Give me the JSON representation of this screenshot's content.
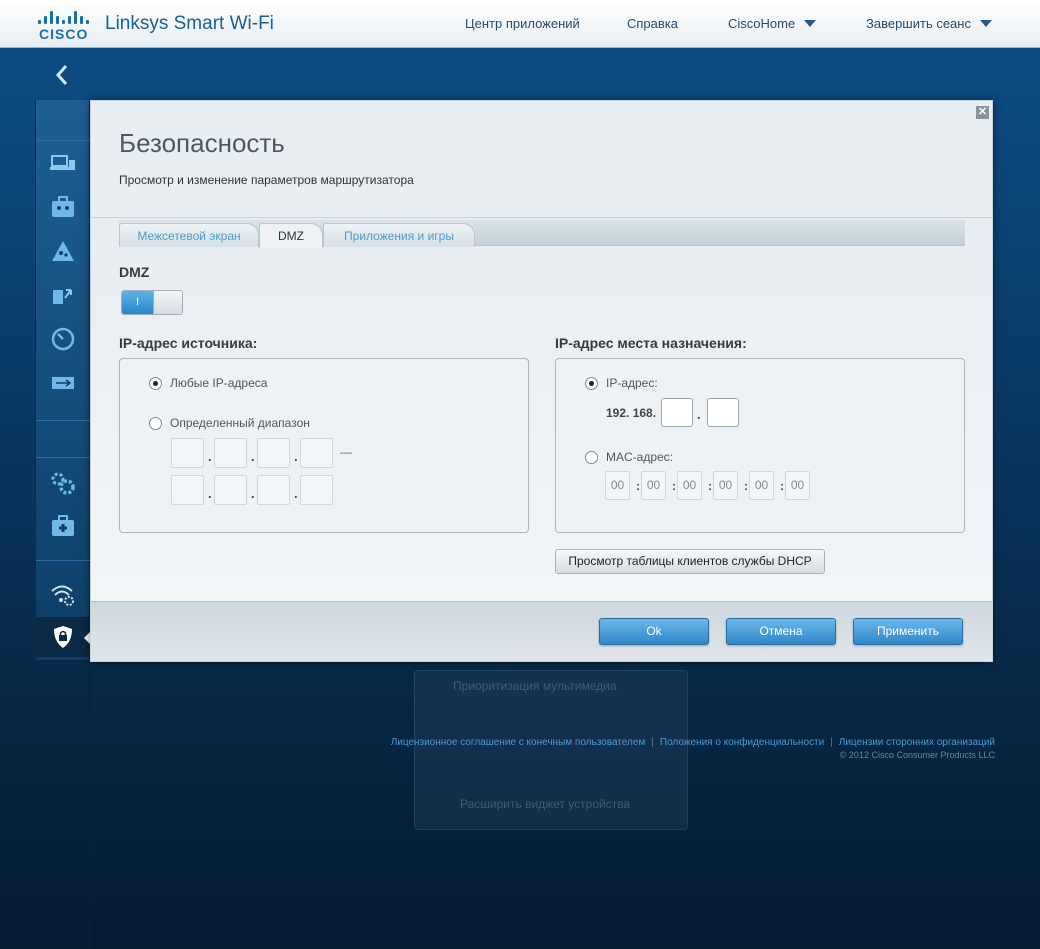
{
  "header": {
    "brand": "Linksys Smart Wi-Fi",
    "logo_text": "CISCO",
    "nav": [
      {
        "label": "Центр приложений",
        "dropdown": false
      },
      {
        "label": "Справка",
        "dropdown": false
      },
      {
        "label": "CiscoHome",
        "dropdown": true
      },
      {
        "label": "Завершить сеанс",
        "dropdown": true
      }
    ]
  },
  "sidebar": {
    "back_icon": "chevron-left-icon",
    "items": [
      {
        "icon": "device-list-icon"
      },
      {
        "icon": "guest-access-icon"
      },
      {
        "icon": "parental-controls-icon"
      },
      {
        "icon": "media-prioritization-icon"
      },
      {
        "icon": "speed-test-icon"
      },
      {
        "icon": "usb-storage-icon"
      },
      {
        "icon": "connectivity-gear-icon"
      },
      {
        "icon": "troubleshooting-icon"
      },
      {
        "icon": "wireless-icon"
      },
      {
        "icon": "security-shield-icon",
        "active": true
      }
    ]
  },
  "dialog": {
    "title": "Безопасность",
    "subtitle": "Просмотр и изменение параметров маршрутизатора",
    "tabs": [
      {
        "label": "Межсетевой экран",
        "active": false
      },
      {
        "label": "DMZ",
        "active": true
      },
      {
        "label": "Приложения и игры",
        "active": false
      }
    ],
    "dmz": {
      "label": "DMZ",
      "toggle_on_text": "I",
      "enabled": true
    },
    "source": {
      "title": "IP-адрес источника:",
      "option_any": "Любые IP-адреса",
      "option_range": "Определенный диапазон",
      "selected": "any",
      "range_dash": "—"
    },
    "destination": {
      "title": "IP-адрес места назначения:",
      "option_ip": "IP-адрес:",
      "ip_prefix": "192. 168.",
      "option_mac": "MAC-адрес:",
      "selected": "ip",
      "mac_values": [
        "00",
        "00",
        "00",
        "00",
        "00",
        "00"
      ]
    },
    "dhcp_button": "Просмотр таблицы клиентов службы DHCP",
    "buttons": {
      "ok": "Ok",
      "cancel": "Отмена",
      "apply": "Применить"
    }
  },
  "background_widget": {
    "title": "Приоритизация мультимедиа",
    "link": "Расширить виджет устройства"
  },
  "footer": {
    "links": [
      "Лицензионное соглашение с конечным пользователем",
      "Положения о конфиденциальности",
      "Лицензии сторонних организаций"
    ],
    "copyright": "© 2012 Cisco Consumer Products LLC"
  },
  "colors": {
    "accent": "#2f86c7",
    "link": "#4a9bd6",
    "brand": "#1b6fa8"
  }
}
